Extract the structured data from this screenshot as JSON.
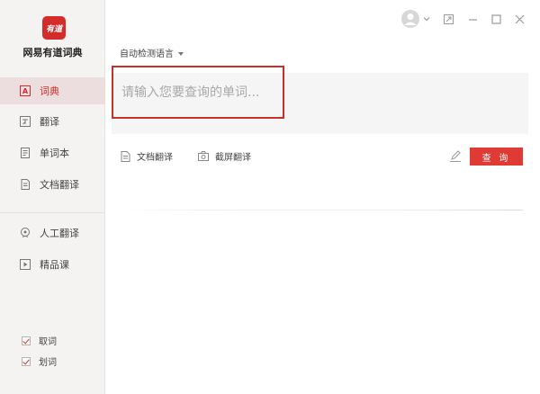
{
  "sidebar": {
    "logo_text": "有道",
    "app_name": "网易有道词典",
    "nav": [
      {
        "label": "词典",
        "icon": "dictionary-icon"
      },
      {
        "label": "翻译",
        "icon": "translate-icon"
      },
      {
        "label": "单词本",
        "icon": "wordbook-icon"
      },
      {
        "label": "文档翻译",
        "icon": "document-translate-icon"
      },
      {
        "label": "人工翻译",
        "icon": "human-translate-icon"
      },
      {
        "label": "精品课",
        "icon": "course-icon"
      }
    ],
    "checks": [
      {
        "label": "取词",
        "checked": true
      },
      {
        "label": "划词",
        "checked": true
      }
    ]
  },
  "main": {
    "language_select": "自动检测语言",
    "search_placeholder": "请输入您要查询的单词...",
    "tools": [
      {
        "label": "文档翻译",
        "icon": "document-icon"
      },
      {
        "label": "截屏翻译",
        "icon": "camera-icon"
      }
    ],
    "search_button": "查 询"
  },
  "colors": {
    "accent": "#e03a34",
    "sidebar_bg": "#f4f3f2"
  }
}
